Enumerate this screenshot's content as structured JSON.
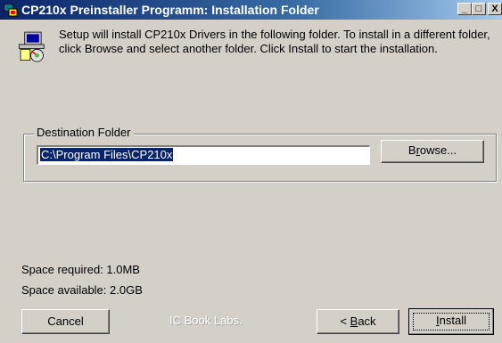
{
  "window": {
    "title": "CP210x Preinstaller Programm: Installation Folder",
    "min_symbol": "_",
    "max_symbol": "□",
    "close_symbol": "X"
  },
  "intro_text": "Setup will install CP210x Drivers in the following folder. To install in a different folder, click Browse and select another folder. Click Install to start the installation.",
  "destination": {
    "legend": "Destination Folder",
    "path": "C:\\Program Files\\CP210x",
    "browse_pre": "B",
    "browse_u": "r",
    "browse_post": "owse..."
  },
  "space": {
    "required": "Space required: 1.0MB",
    "available": "Space available: 2.0GB"
  },
  "footer": {
    "cancel": "Cancel",
    "brand": "IC Book Labs.",
    "back_pre": "< ",
    "back_u": "B",
    "back_post": "ack",
    "install_u": "I",
    "install_post": "nstall"
  },
  "colors": {
    "dialog_bg": "#d4d0c8",
    "title_active": "#0a246a",
    "selection": "#0a246a"
  },
  "icons": [
    "app-icon",
    "setup-computer-icon"
  ]
}
